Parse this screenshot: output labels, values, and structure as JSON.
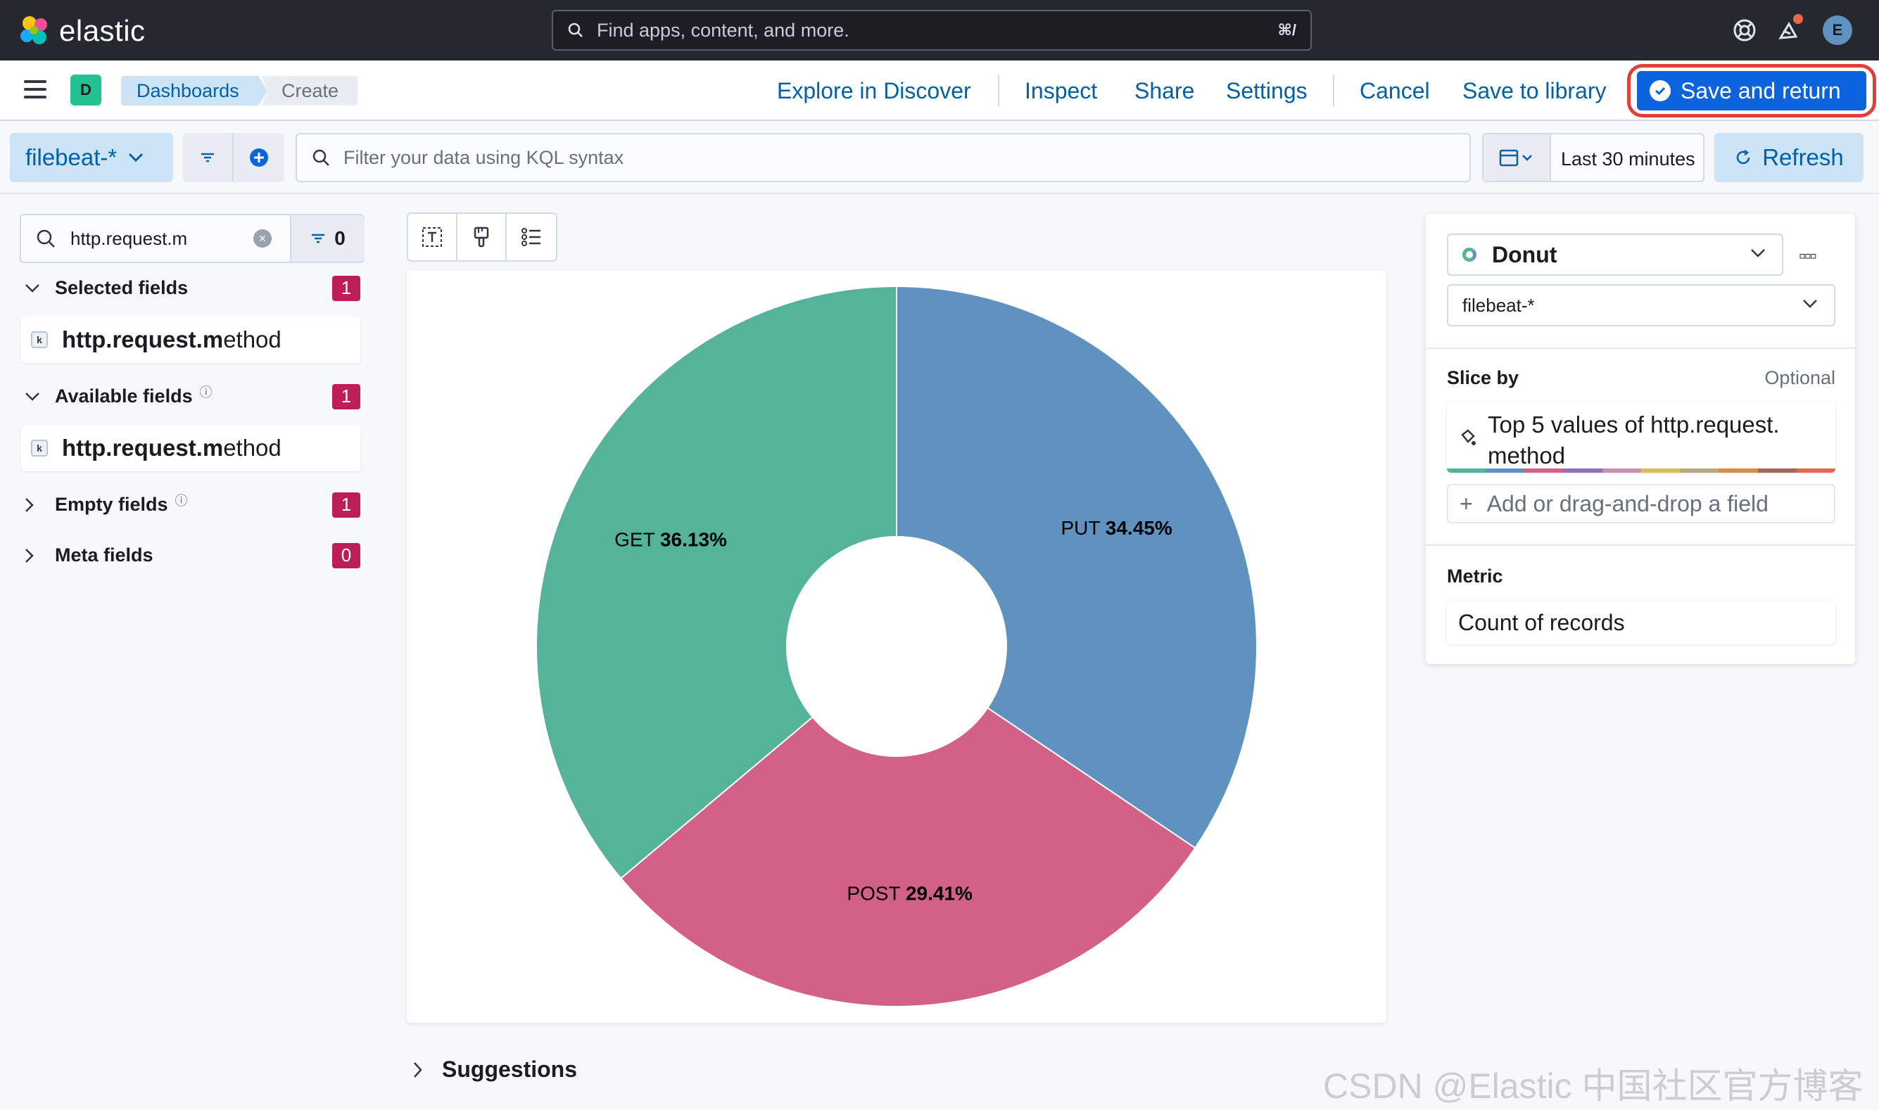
{
  "header": {
    "brand": "elastic",
    "search_placeholder": "Find apps, content, and more.",
    "search_shortcut": "⌘/",
    "avatar_initial": "E",
    "icons": [
      "help-icon",
      "newsfeed-icon"
    ]
  },
  "appbar": {
    "space_initial": "D",
    "breadcrumbs": [
      "Dashboards",
      "Create"
    ],
    "actions": {
      "explore": "Explore in Discover",
      "inspect": "Inspect",
      "share": "Share",
      "settings": "Settings",
      "cancel": "Cancel",
      "save_library": "Save to library",
      "save_return": "Save and return"
    }
  },
  "filterbar": {
    "data_view": "filebeat-*",
    "kql_placeholder": "Filter your data using KQL syntax",
    "time_range": "Last 30 minutes",
    "refresh": "Refresh"
  },
  "fields": {
    "search_value": "http.request.m",
    "filter_count": "0",
    "groups": {
      "selected": {
        "label": "Selected fields",
        "count": "1"
      },
      "available": {
        "label": "Available fields",
        "count": "1"
      },
      "empty": {
        "label": "Empty fields",
        "count": "1"
      },
      "meta": {
        "label": "Meta fields",
        "count": "0"
      }
    },
    "selected_field": {
      "match": "http.request.m",
      "rest": "ethod",
      "type": "k"
    },
    "available_field": {
      "match": "http.request.m",
      "rest": "ethod",
      "type": "k"
    }
  },
  "chart_data": {
    "type": "pie",
    "variant": "donut",
    "categories": [
      "PUT",
      "POST",
      "GET"
    ],
    "values": [
      34.45,
      29.41,
      36.13
    ],
    "labels": [
      "34.45%",
      "29.41%",
      "36.13%"
    ],
    "colors": [
      "#6092c0",
      "#d36086",
      "#54b399"
    ]
  },
  "suggestions": {
    "label": "Suggestions"
  },
  "config": {
    "viz_type": "Donut",
    "data_view": "filebeat-*",
    "slice_by_label": "Slice by",
    "slice_by_optional": "Optional",
    "slice_by_value": "Top 5 values of http.request. method",
    "add_field": "Add or drag-and-drop a field",
    "metric_label": "Metric",
    "metric_value": "Count of records",
    "palette": [
      "#54b399",
      "#6092c0",
      "#d36086",
      "#9170b8",
      "#ca8eae",
      "#d6bf57",
      "#b9a888",
      "#da8b45",
      "#aa6556",
      "#e7664c"
    ]
  },
  "watermark": "CSDN @Elastic 中国社区官方博客"
}
